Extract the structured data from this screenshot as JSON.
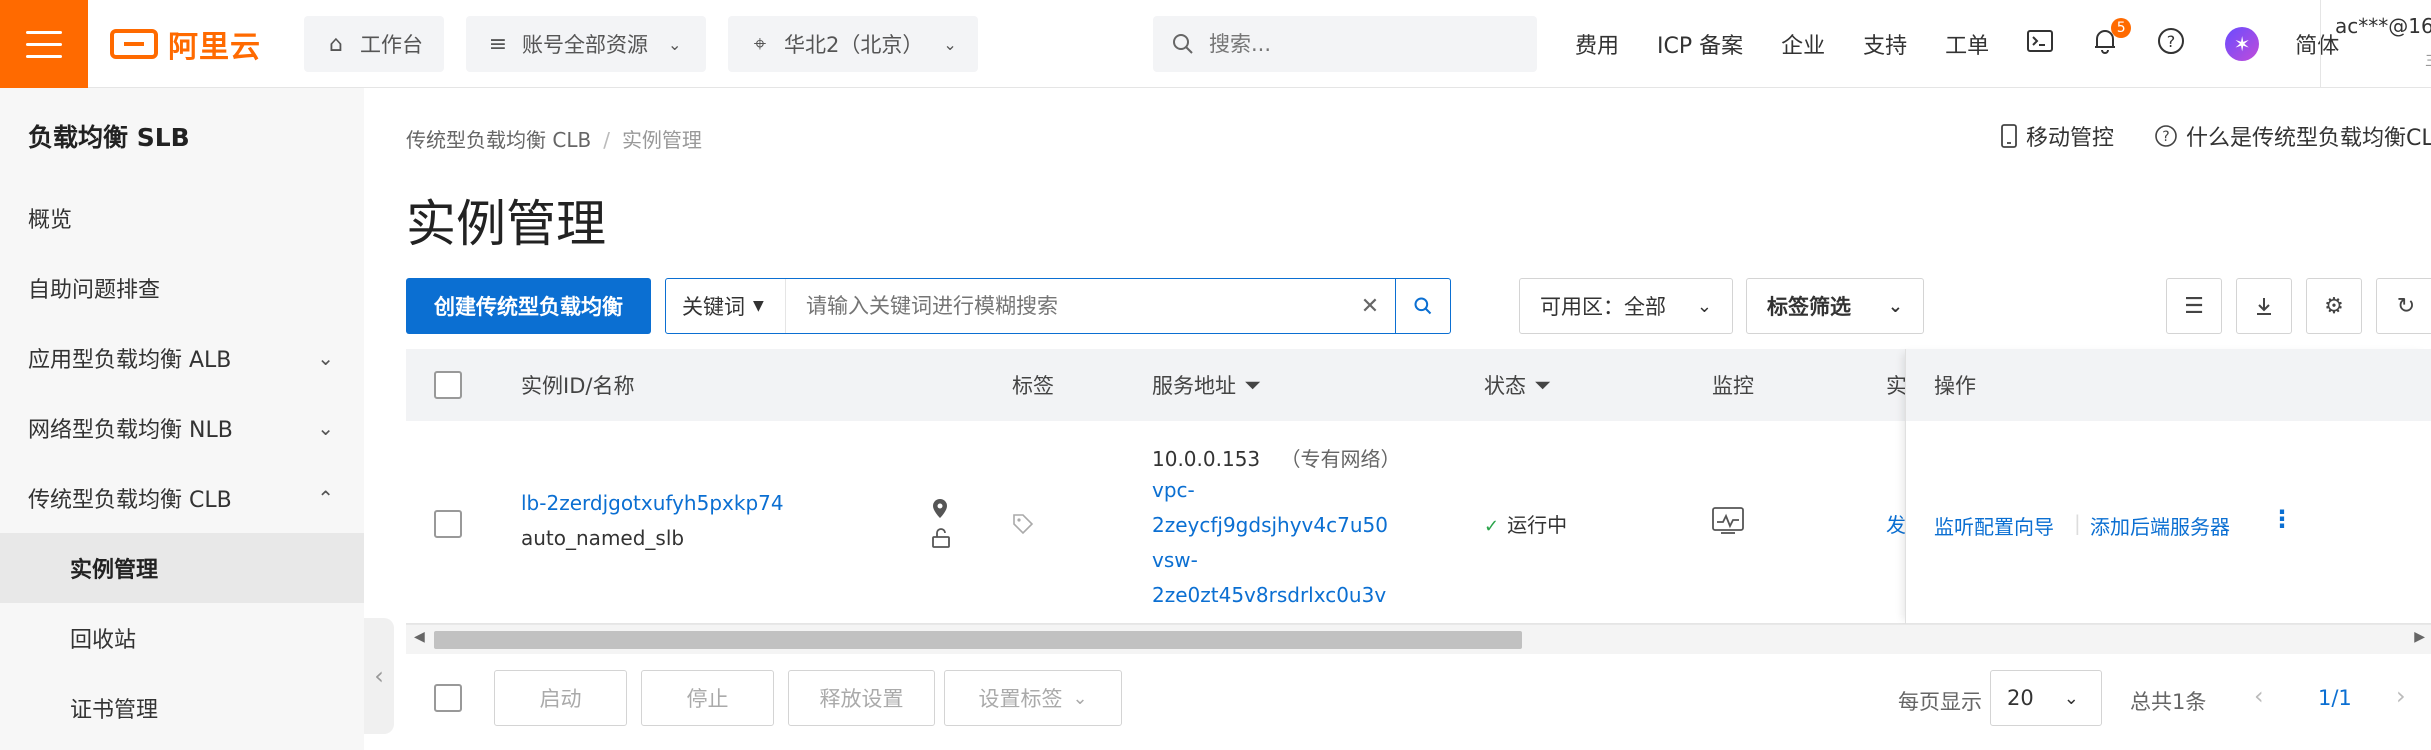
{
  "topbar": {
    "logo_text": "阿里云",
    "workbench": "工作台",
    "resources": "账号全部资源",
    "region": "华北2（北京）",
    "search_placeholder": "搜索...",
    "links": [
      "费用",
      "ICP 备案",
      "企业",
      "支持",
      "工单"
    ],
    "notification_count": "5",
    "lang": "简体",
    "user": "ac***@16",
    "user_sub": "主",
    "brand_color": "#ff6a00"
  },
  "sidebar": {
    "title": "负载均衡 SLB",
    "items": [
      {
        "label": "概览"
      },
      {
        "label": "自助问题排查"
      },
      {
        "label": "应用型负载均衡 ALB"
      },
      {
        "label": "网络型负载均衡 NLB"
      },
      {
        "label": "传统型负载均衡 CLB"
      },
      {
        "label": "实例管理"
      },
      {
        "label": "回收站"
      },
      {
        "label": "证书管理"
      }
    ]
  },
  "breadcrumb": {
    "parent": "传统型负载均衡 CLB",
    "current": "实例管理"
  },
  "header_links": {
    "mobile": "移动管控",
    "whatis": "什么是传统型负载均衡CLB"
  },
  "page_title": "实例管理",
  "toolbar": {
    "create_button": "创建传统型负载均衡",
    "keyword_select": "关键词",
    "keyword_placeholder": "请输入关键词进行模糊搜索",
    "zone_label": "可用区：",
    "zone_value": "全部",
    "tag_filter": "标签筛选",
    "accent_color": "#0b6fd2"
  },
  "table": {
    "headers": {
      "id_name": "实例ID/名称",
      "tags": "标签",
      "address": "服务地址",
      "status": "状态",
      "monitor": "监控",
      "instance": "实",
      "ops": "操作"
    },
    "rows": [
      {
        "id": "lb-2zerdjgotxufyh5pxkp74",
        "name": "auto_named_slb",
        "ip": "10.0.0.153",
        "network": "（专有网络）",
        "vpc_line1": "vpc-",
        "vpc_line2": "2zeycfj9gdsjhyv4c7u50",
        "vsw_line1": "vsw-",
        "vsw_line2": "2ze0zt45v8rsdrlxc0u3v",
        "status": "运行中",
        "instance_prefix": "发",
        "op1": "监听配置向导",
        "op2": "添加后端服务器"
      }
    ]
  },
  "footer": {
    "start": "启动",
    "stop": "停止",
    "release": "释放设置",
    "set_tags": "设置标签",
    "per_page_label": "每页显示",
    "per_page": "20",
    "total": "总共1条",
    "page": "1/1"
  }
}
